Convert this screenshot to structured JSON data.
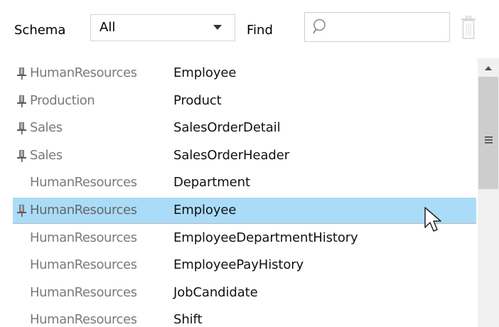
{
  "toolbar": {
    "schema_label": "Schema",
    "schema_value": "All",
    "find_label": "Find",
    "find_placeholder": ""
  },
  "pinned": [
    {
      "schema": "HumanResources",
      "table": "Employee",
      "pinned": true
    },
    {
      "schema": "Production",
      "table": "Product",
      "pinned": true
    },
    {
      "schema": "Sales",
      "table": "SalesOrderDetail",
      "pinned": true
    },
    {
      "schema": "Sales",
      "table": "SalesOrderHeader",
      "pinned": true
    }
  ],
  "all": [
    {
      "schema": "HumanResources",
      "table": "Department",
      "pinned": false
    },
    {
      "schema": "HumanResources",
      "table": "Employee",
      "pinned": true,
      "selected": true
    },
    {
      "schema": "HumanResources",
      "table": "EmployeeDepartmentHistory",
      "pinned": false
    },
    {
      "schema": "HumanResources",
      "table": "EmployeePayHistory",
      "pinned": false
    },
    {
      "schema": "HumanResources",
      "table": "JobCandidate",
      "pinned": false
    },
    {
      "schema": "HumanResources",
      "table": "Shift",
      "pinned": false
    }
  ],
  "colors": {
    "selection": "#aadcf8",
    "schema_text": "#7a7a7a",
    "scroll_thumb": "#cdcdcd"
  },
  "icons": [
    "chevron-down-icon",
    "search-icon",
    "trash-icon",
    "pin-icon",
    "scroll-up-icon",
    "scroll-grip-icon",
    "mouse-cursor-icon"
  ]
}
